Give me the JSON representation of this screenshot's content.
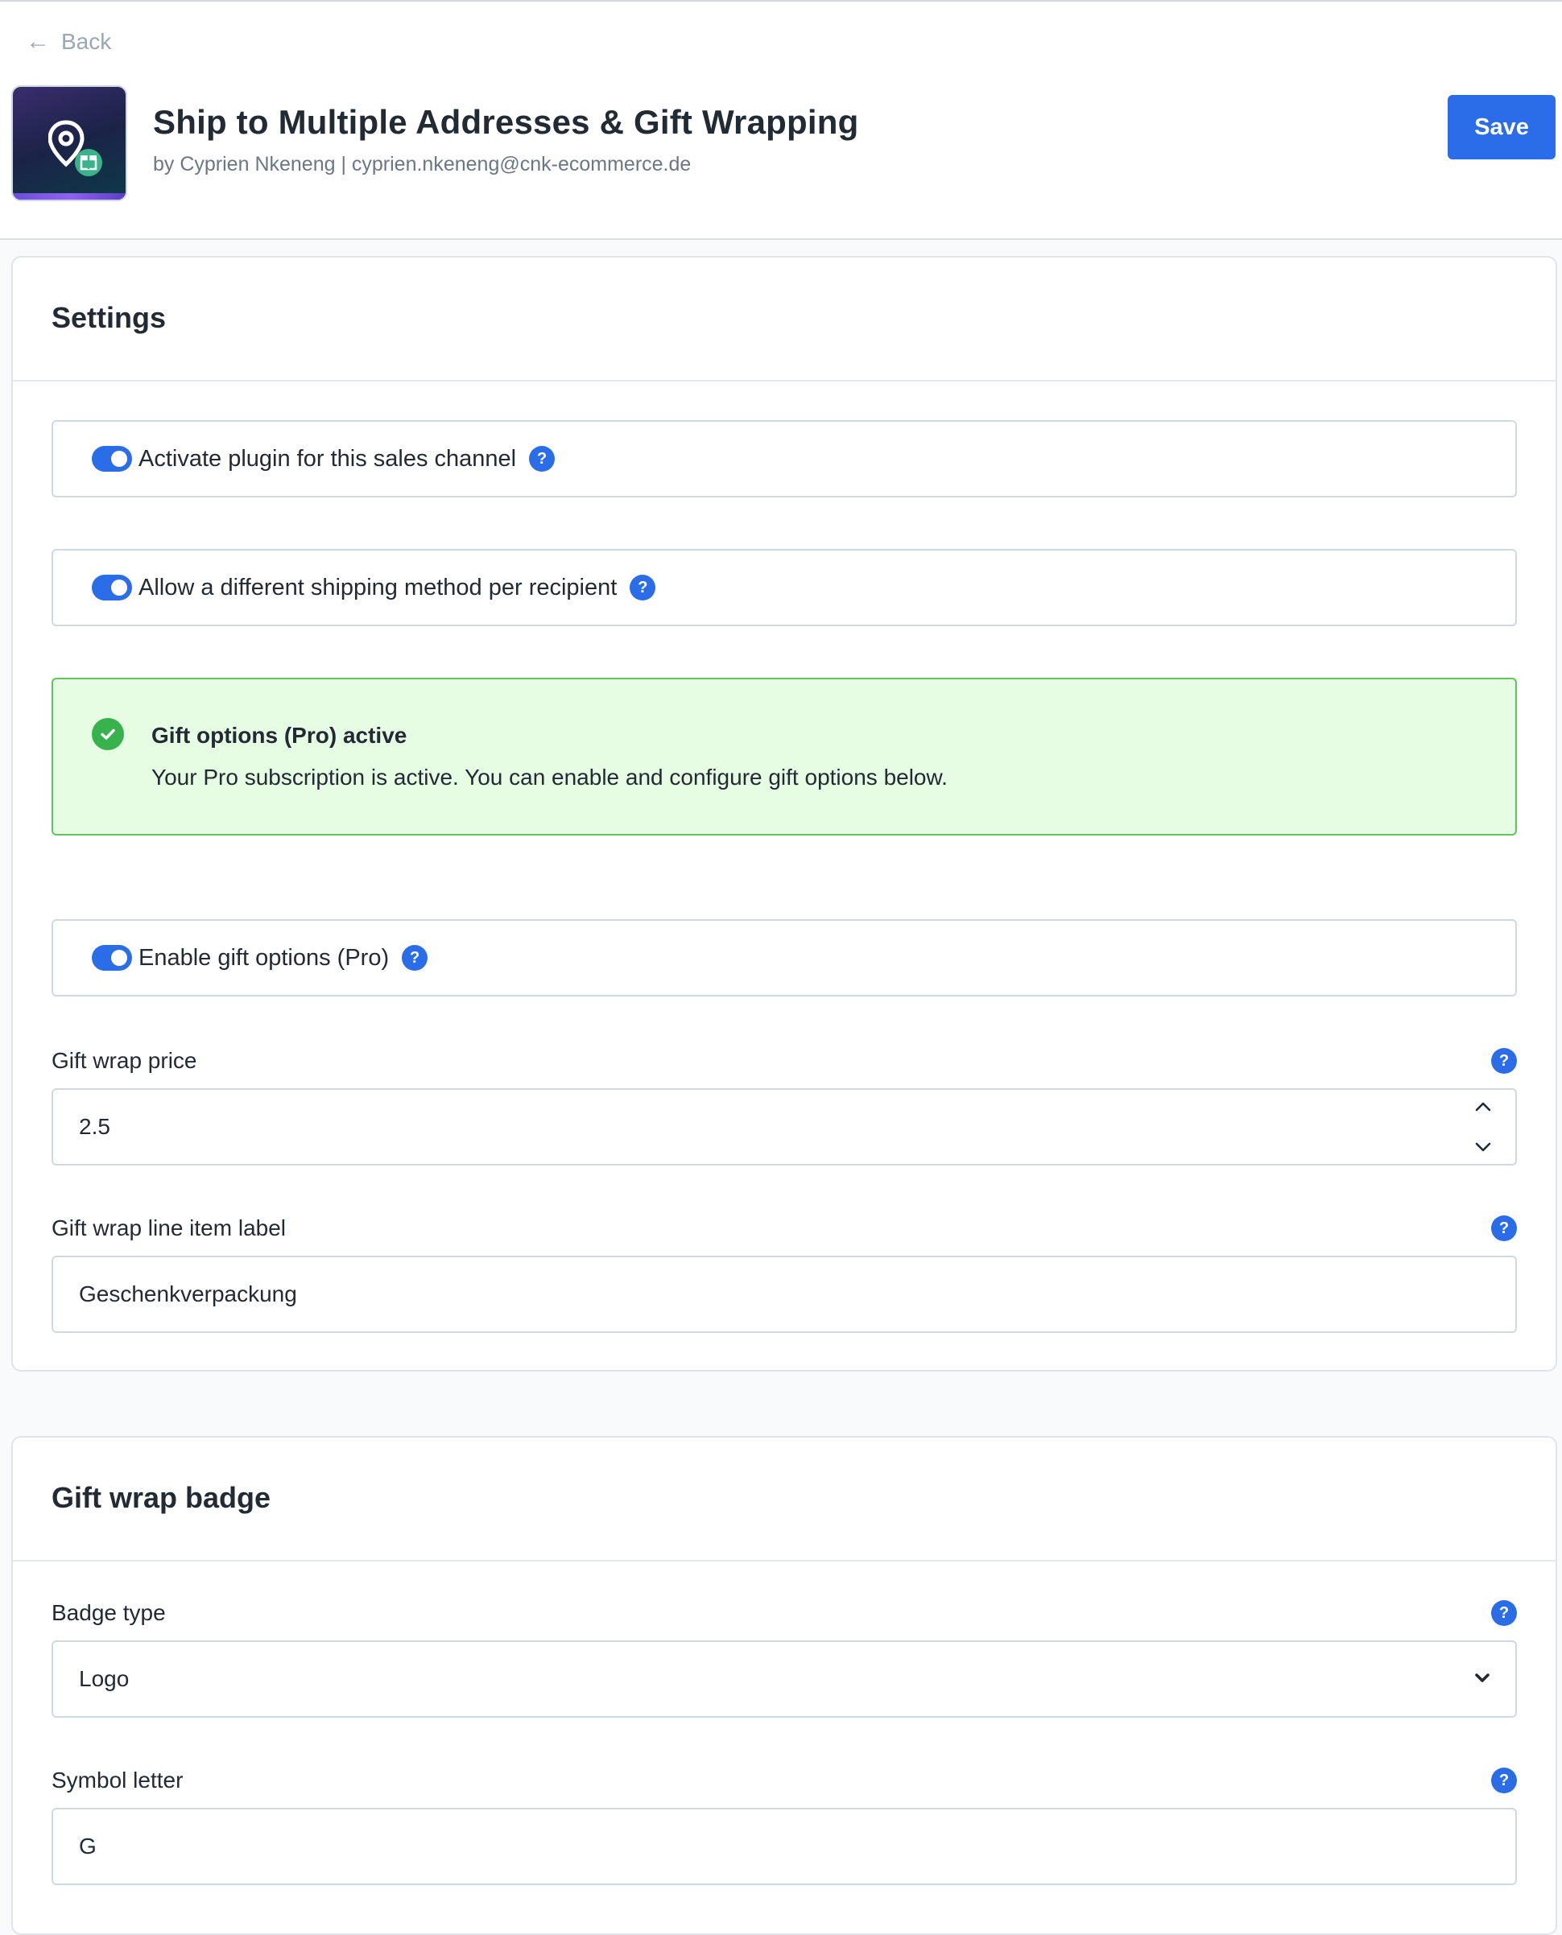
{
  "header": {
    "back_label": "Back",
    "title": "Ship to Multiple Addresses & Gift Wrapping",
    "subtitle": "by Cyprien Nkeneng | cyprien.nkeneng@cnk-ecommerce.de",
    "save_label": "Save"
  },
  "settings": {
    "title": "Settings",
    "toggles": [
      {
        "label": "Activate plugin for this sales channel",
        "enabled": true
      },
      {
        "label": "Allow a different shipping method per recipient",
        "enabled": true
      }
    ],
    "notice": {
      "title": "Gift options (Pro) active",
      "body": "Your Pro subscription is active. You can enable and configure gift options below."
    },
    "gift_toggle": {
      "label": "Enable gift options (Pro)",
      "enabled": true
    },
    "gift_wrap_price": {
      "label": "Gift wrap price",
      "value": "2.5"
    },
    "gift_wrap_line_label": {
      "label": "Gift wrap line item label",
      "value": "Geschenkverpackung"
    }
  },
  "badge": {
    "title": "Gift wrap badge",
    "badge_type": {
      "label": "Badge type",
      "value": "Logo"
    },
    "symbol_letter": {
      "label": "Symbol letter",
      "value": "G"
    }
  },
  "icons": {
    "help": "?",
    "back": "←"
  },
  "colors": {
    "accent": "#2b6de8",
    "success_bg": "#e6fce3",
    "success_border": "#5fc55a",
    "success_icon": "#37b24d"
  }
}
